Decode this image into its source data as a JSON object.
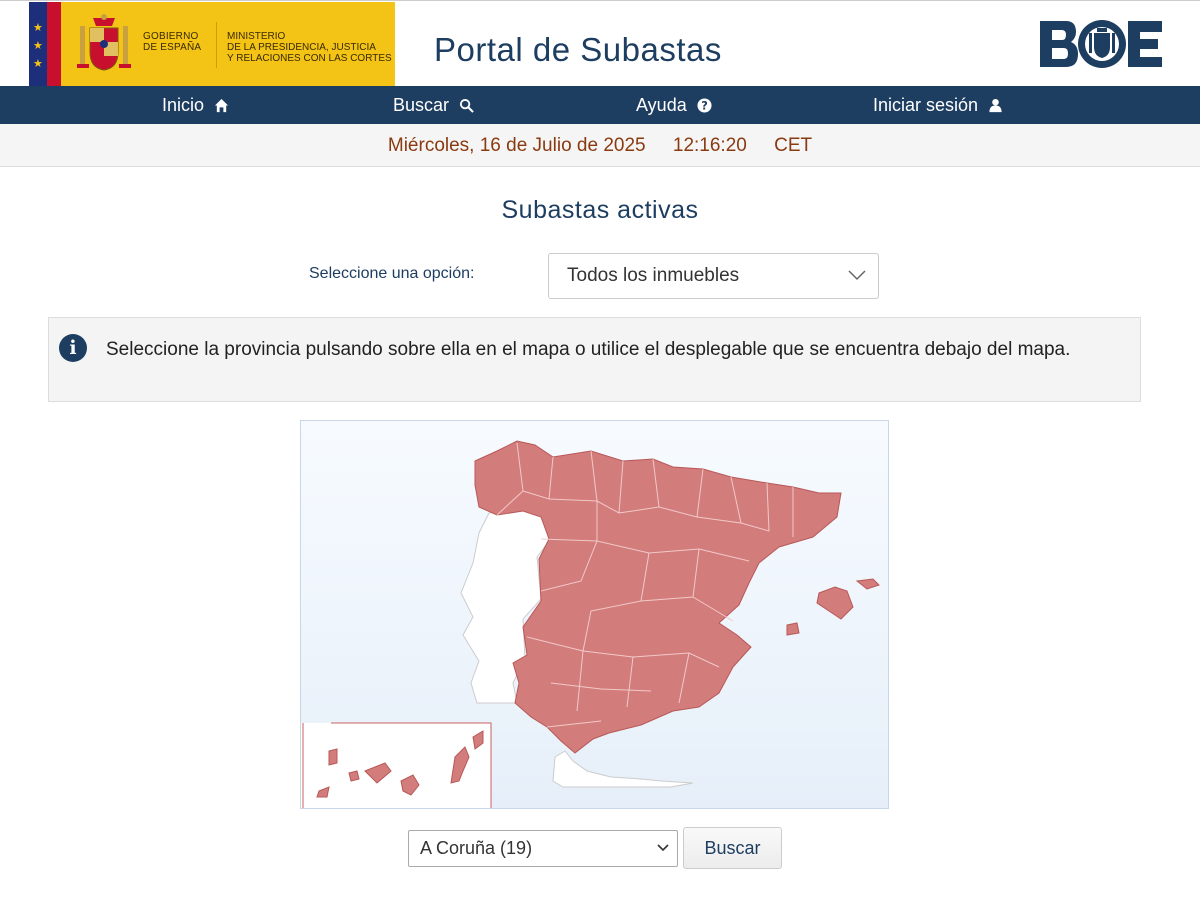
{
  "header": {
    "gov_line1": "Gobierno",
    "gov_line2": "de España",
    "ministry_line1": "Ministerio",
    "ministry_line2": "de la Presidencia, Justicia",
    "ministry_line3": "y Relaciones con las Cortes",
    "portal_title": "Portal de Subastas",
    "logo": "BOE"
  },
  "nav": {
    "items": [
      {
        "label": "Inicio",
        "icon": "home-icon"
      },
      {
        "label": "Buscar",
        "icon": "search-icon"
      },
      {
        "label": "Ayuda",
        "icon": "help-icon"
      },
      {
        "label": "Iniciar sesión",
        "icon": "user-icon"
      }
    ]
  },
  "datebar": {
    "date": "Miércoles, 16 de Julio de 2025",
    "time": "12:16:20",
    "zone": "CET"
  },
  "main": {
    "title": "Subastas activas",
    "select_label": "Seleccione una opción:",
    "select_value": "Todos los inmuebles",
    "info_text": "Seleccione la provincia pulsando sobre ella en el mapa o utilice el desplegable que se encuentra debajo del mapa.",
    "province_value": "A Coruña (19)",
    "search_button": "Buscar"
  },
  "colors": {
    "brand_blue": "#1d3e61",
    "gov_yellow": "#f3c316",
    "map_fill": "#d37c7c",
    "date_text": "#8a3a10"
  }
}
